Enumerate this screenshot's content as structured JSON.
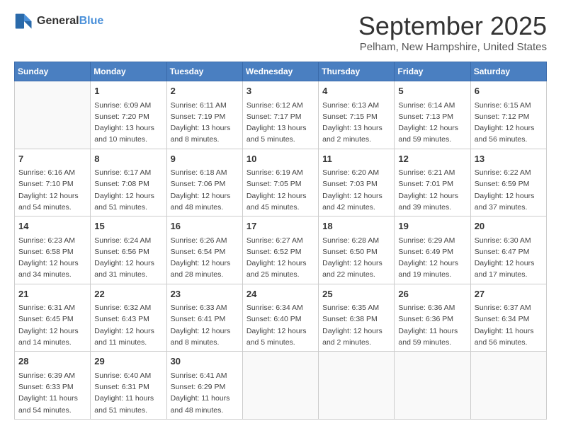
{
  "header": {
    "logo": {
      "general": "General",
      "blue": "Blue"
    },
    "title": "September 2025",
    "location": "Pelham, New Hampshire, United States"
  },
  "days_of_week": [
    "Sunday",
    "Monday",
    "Tuesday",
    "Wednesday",
    "Thursday",
    "Friday",
    "Saturday"
  ],
  "weeks": [
    [
      {
        "day": "",
        "data": ""
      },
      {
        "day": "1",
        "data": "Sunrise: 6:09 AM\nSunset: 7:20 PM\nDaylight: 13 hours\nand 10 minutes."
      },
      {
        "day": "2",
        "data": "Sunrise: 6:11 AM\nSunset: 7:19 PM\nDaylight: 13 hours\nand 8 minutes."
      },
      {
        "day": "3",
        "data": "Sunrise: 6:12 AM\nSunset: 7:17 PM\nDaylight: 13 hours\nand 5 minutes."
      },
      {
        "day": "4",
        "data": "Sunrise: 6:13 AM\nSunset: 7:15 PM\nDaylight: 13 hours\nand 2 minutes."
      },
      {
        "day": "5",
        "data": "Sunrise: 6:14 AM\nSunset: 7:13 PM\nDaylight: 12 hours\nand 59 minutes."
      },
      {
        "day": "6",
        "data": "Sunrise: 6:15 AM\nSunset: 7:12 PM\nDaylight: 12 hours\nand 56 minutes."
      }
    ],
    [
      {
        "day": "7",
        "data": "Sunrise: 6:16 AM\nSunset: 7:10 PM\nDaylight: 12 hours\nand 54 minutes."
      },
      {
        "day": "8",
        "data": "Sunrise: 6:17 AM\nSunset: 7:08 PM\nDaylight: 12 hours\nand 51 minutes."
      },
      {
        "day": "9",
        "data": "Sunrise: 6:18 AM\nSunset: 7:06 PM\nDaylight: 12 hours\nand 48 minutes."
      },
      {
        "day": "10",
        "data": "Sunrise: 6:19 AM\nSunset: 7:05 PM\nDaylight: 12 hours\nand 45 minutes."
      },
      {
        "day": "11",
        "data": "Sunrise: 6:20 AM\nSunset: 7:03 PM\nDaylight: 12 hours\nand 42 minutes."
      },
      {
        "day": "12",
        "data": "Sunrise: 6:21 AM\nSunset: 7:01 PM\nDaylight: 12 hours\nand 39 minutes."
      },
      {
        "day": "13",
        "data": "Sunrise: 6:22 AM\nSunset: 6:59 PM\nDaylight: 12 hours\nand 37 minutes."
      }
    ],
    [
      {
        "day": "14",
        "data": "Sunrise: 6:23 AM\nSunset: 6:58 PM\nDaylight: 12 hours\nand 34 minutes."
      },
      {
        "day": "15",
        "data": "Sunrise: 6:24 AM\nSunset: 6:56 PM\nDaylight: 12 hours\nand 31 minutes."
      },
      {
        "day": "16",
        "data": "Sunrise: 6:26 AM\nSunset: 6:54 PM\nDaylight: 12 hours\nand 28 minutes."
      },
      {
        "day": "17",
        "data": "Sunrise: 6:27 AM\nSunset: 6:52 PM\nDaylight: 12 hours\nand 25 minutes."
      },
      {
        "day": "18",
        "data": "Sunrise: 6:28 AM\nSunset: 6:50 PM\nDaylight: 12 hours\nand 22 minutes."
      },
      {
        "day": "19",
        "data": "Sunrise: 6:29 AM\nSunset: 6:49 PM\nDaylight: 12 hours\nand 19 minutes."
      },
      {
        "day": "20",
        "data": "Sunrise: 6:30 AM\nSunset: 6:47 PM\nDaylight: 12 hours\nand 17 minutes."
      }
    ],
    [
      {
        "day": "21",
        "data": "Sunrise: 6:31 AM\nSunset: 6:45 PM\nDaylight: 12 hours\nand 14 minutes."
      },
      {
        "day": "22",
        "data": "Sunrise: 6:32 AM\nSunset: 6:43 PM\nDaylight: 12 hours\nand 11 minutes."
      },
      {
        "day": "23",
        "data": "Sunrise: 6:33 AM\nSunset: 6:41 PM\nDaylight: 12 hours\nand 8 minutes."
      },
      {
        "day": "24",
        "data": "Sunrise: 6:34 AM\nSunset: 6:40 PM\nDaylight: 12 hours\nand 5 minutes."
      },
      {
        "day": "25",
        "data": "Sunrise: 6:35 AM\nSunset: 6:38 PM\nDaylight: 12 hours\nand 2 minutes."
      },
      {
        "day": "26",
        "data": "Sunrise: 6:36 AM\nSunset: 6:36 PM\nDaylight: 11 hours\nand 59 minutes."
      },
      {
        "day": "27",
        "data": "Sunrise: 6:37 AM\nSunset: 6:34 PM\nDaylight: 11 hours\nand 56 minutes."
      }
    ],
    [
      {
        "day": "28",
        "data": "Sunrise: 6:39 AM\nSunset: 6:33 PM\nDaylight: 11 hours\nand 54 minutes."
      },
      {
        "day": "29",
        "data": "Sunrise: 6:40 AM\nSunset: 6:31 PM\nDaylight: 11 hours\nand 51 minutes."
      },
      {
        "day": "30",
        "data": "Sunrise: 6:41 AM\nSunset: 6:29 PM\nDaylight: 11 hours\nand 48 minutes."
      },
      {
        "day": "",
        "data": ""
      },
      {
        "day": "",
        "data": ""
      },
      {
        "day": "",
        "data": ""
      },
      {
        "day": "",
        "data": ""
      }
    ]
  ]
}
